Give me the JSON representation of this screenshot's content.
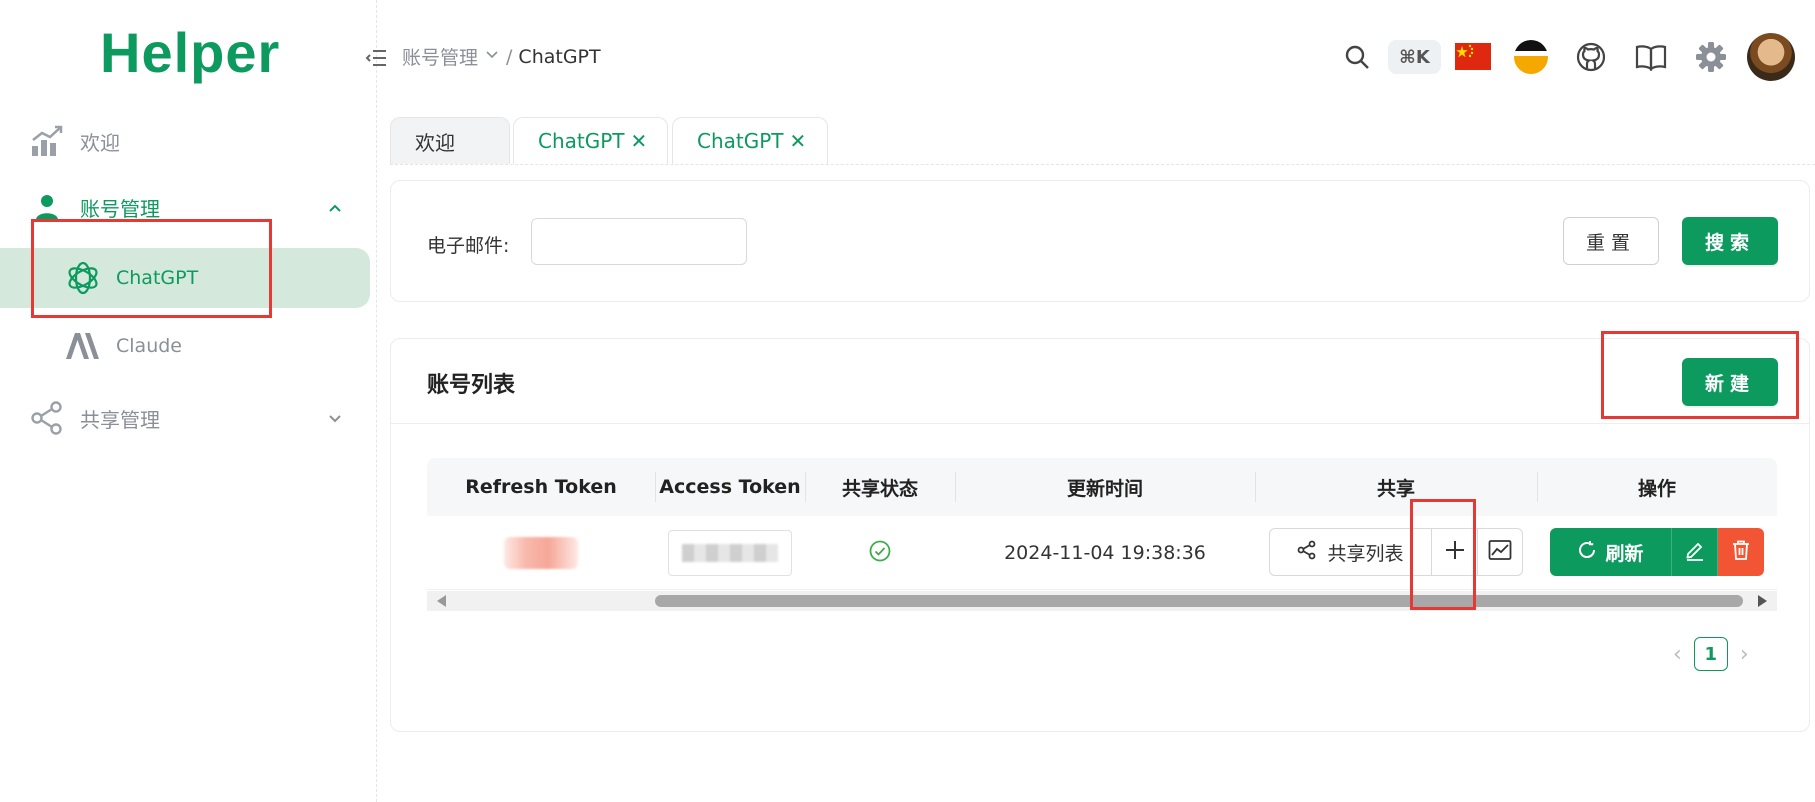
{
  "app": {
    "logo": "Helper"
  },
  "sidebar": {
    "items": [
      {
        "label": "欢迎",
        "icon": "chart-icon"
      },
      {
        "label": "账号管理",
        "icon": "user-icon",
        "expanded": true,
        "children": [
          {
            "label": "ChatGPT",
            "icon": "openai-icon",
            "active": true
          },
          {
            "label": "Claude",
            "icon": "anthropic-icon"
          }
        ]
      },
      {
        "label": "共享管理",
        "icon": "share-icon",
        "expanded": false
      }
    ]
  },
  "header": {
    "breadcrumb": {
      "parent": "账号管理",
      "current": "ChatGPT",
      "separator": "/"
    },
    "kbd": "⌘K"
  },
  "tabs": [
    {
      "label": "欢迎",
      "closable": false
    },
    {
      "label": "ChatGPT",
      "closable": true
    },
    {
      "label": "ChatGPT",
      "closable": true
    }
  ],
  "search": {
    "email_label": "电子邮件:",
    "email_value": "",
    "reset_label": "重置",
    "search_label": "搜索"
  },
  "list": {
    "title": "账号列表",
    "new_label": "新建",
    "columns": [
      "Refresh Token",
      "Access Token",
      "共享状态",
      "更新时间",
      "共享",
      "操作"
    ],
    "rows": [
      {
        "updated": "2024-11-04 19:38:36",
        "share_list_label": "共享列表",
        "refresh_label": "刷新"
      }
    ],
    "page": "1"
  },
  "colors": {
    "primary": "#0d9a5f",
    "danger": "#f25533",
    "annotation": "#e53935"
  }
}
